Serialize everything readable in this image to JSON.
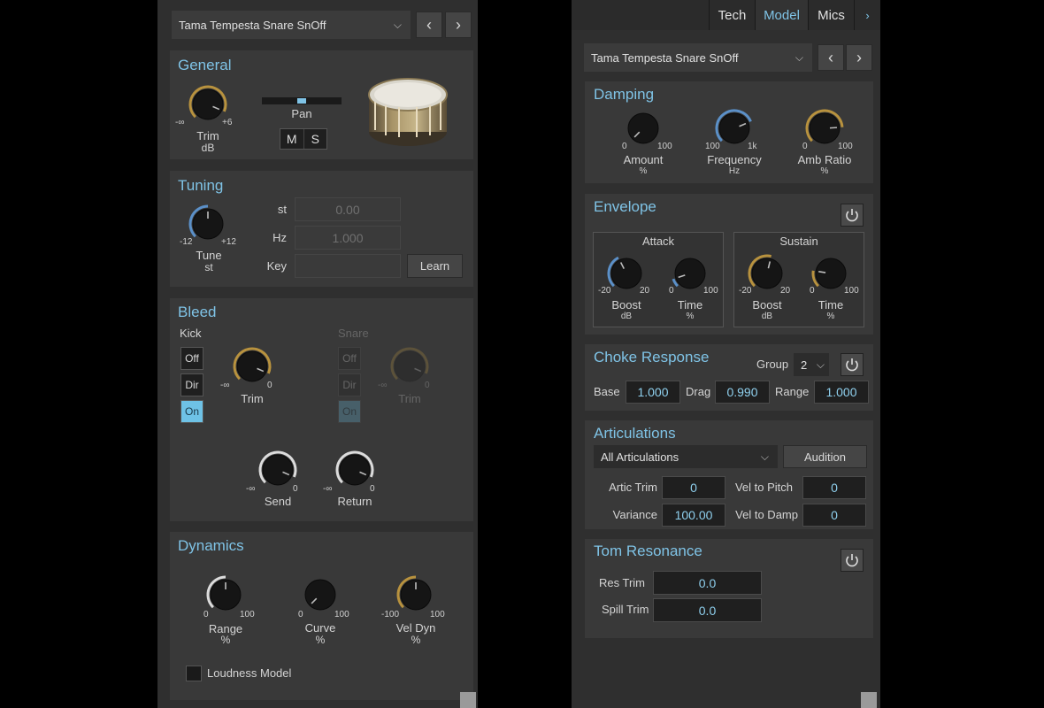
{
  "left": {
    "preset": "Tama Tempesta Snare SnOff",
    "general": {
      "title": "General",
      "trim": {
        "label": "Trim",
        "unit": "dB",
        "min": "-∞",
        "max": "+6"
      },
      "pan_label": "Pan",
      "mute": "M",
      "solo": "S"
    },
    "tuning": {
      "title": "Tuning",
      "tune": {
        "label": "Tune",
        "unit": "st",
        "min": "-12",
        "max": "+12"
      },
      "st_label": "st",
      "st_value": "0.00",
      "hz_label": "Hz",
      "hz_value": "1.000",
      "key_label": "Key",
      "key_value": "",
      "learn": "Learn"
    },
    "bleed": {
      "title": "Bleed",
      "kick": {
        "label": "Kick",
        "off": "Off",
        "dir": "Dir",
        "on": "On",
        "trim": "Trim",
        "min": "-∞",
        "max": "0"
      },
      "snare": {
        "label": "Snare",
        "off": "Off",
        "dir": "Dir",
        "on": "On",
        "trim": "Trim",
        "min": "-∞",
        "max": "0"
      },
      "send": {
        "label": "Send",
        "min": "-∞",
        "max": "0"
      },
      "ret": {
        "label": "Return",
        "min": "-∞",
        "max": "0"
      }
    },
    "dynamics": {
      "title": "Dynamics",
      "range": {
        "label": "Range",
        "unit": "%",
        "min": "0",
        "max": "100"
      },
      "curve": {
        "label": "Curve",
        "unit": "%",
        "min": "0",
        "max": "100"
      },
      "veldyn": {
        "label": "Vel Dyn",
        "unit": "%",
        "min": "-100",
        "max": "100"
      },
      "loudness": "Loudness Model"
    }
  },
  "right": {
    "tabs": [
      "Tech",
      "Model",
      "Mics"
    ],
    "tab_extra": "›",
    "preset": "Tama Tempesta Snare SnOff",
    "damping": {
      "title": "Damping",
      "amount": {
        "label": "Amount",
        "unit": "%",
        "min": "0",
        "max": "100"
      },
      "frequency": {
        "label": "Frequency",
        "unit": "Hz",
        "min": "100",
        "max": "1k"
      },
      "ambratio": {
        "label": "Amb Ratio",
        "unit": "%",
        "min": "0",
        "max": "100"
      }
    },
    "envelope": {
      "title": "Envelope",
      "attack": "Attack",
      "sustain": "Sustain",
      "a_boost": {
        "label": "Boost",
        "unit": "dB",
        "min": "-20",
        "max": "20"
      },
      "a_time": {
        "label": "Time",
        "unit": "%",
        "min": "0",
        "max": "100"
      },
      "s_boost": {
        "label": "Boost",
        "unit": "dB",
        "min": "-20",
        "max": "20"
      },
      "s_time": {
        "label": "Time",
        "unit": "%",
        "min": "0",
        "max": "100"
      }
    },
    "choke": {
      "title": "Choke Response",
      "group_label": "Group",
      "group_value": "2",
      "base_label": "Base",
      "base": "1.000",
      "drag_label": "Drag",
      "drag": "0.990",
      "range_label": "Range",
      "range": "1.000"
    },
    "artic": {
      "title": "Articulations",
      "select": "All Articulations",
      "audition": "Audition",
      "artic_trim_label": "Artic Trim",
      "artic_trim": "0",
      "vel_pitch_label": "Vel to Pitch",
      "vel_pitch": "0",
      "variance_label": "Variance",
      "variance": "100.00",
      "vel_damp_label": "Vel to Damp",
      "vel_damp": "0"
    },
    "tom": {
      "title": "Tom Resonance",
      "res_label": "Res Trim",
      "res": "0.0",
      "spill_label": "Spill Trim",
      "spill": "0.0"
    }
  },
  "colors": {
    "accent": "#7fc3e6",
    "gold": "#b8923e",
    "blue": "#5b90c8",
    "white": "#dcdcdc"
  }
}
